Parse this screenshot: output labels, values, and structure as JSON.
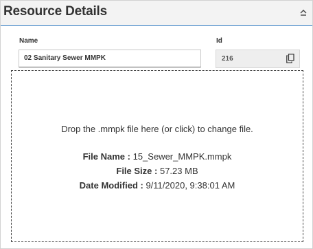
{
  "panel": {
    "title": "Resource Details",
    "collapse_icon": "chevron-up-icon"
  },
  "fields": {
    "name_label": "Name",
    "name_value": "02 Sanitary Sewer MMPK",
    "id_label": "Id",
    "id_value": "216",
    "copy_icon": "copy-icon"
  },
  "dropzone": {
    "instruction": "Drop the .mmpk file here (or click) to change file.",
    "file_name_label": "File Name :",
    "file_name_value": "15_Sewer_MMPK.mmpk",
    "file_size_label": "File Size :",
    "file_size_value": "57.23 MB",
    "date_modified_label": "Date Modified :",
    "date_modified_value": "9/11/2020, 9:38:01 AM"
  },
  "colors": {
    "header_underline": "#2e7bc4",
    "text": "#333333"
  }
}
